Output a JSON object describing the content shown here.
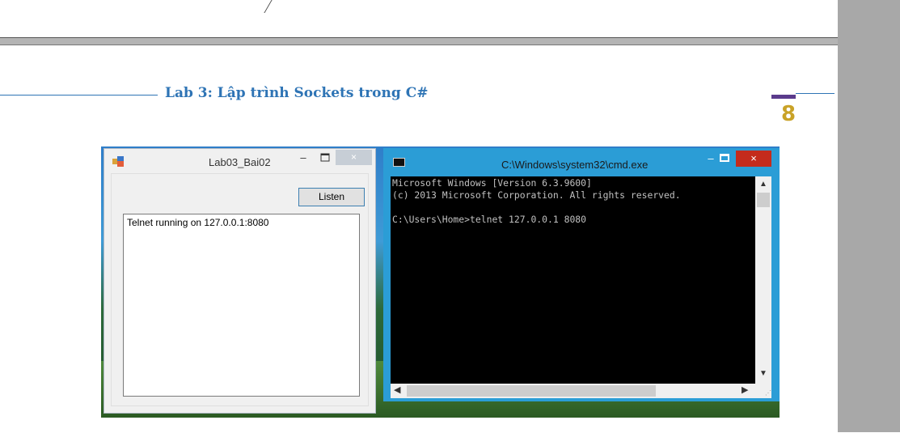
{
  "document": {
    "header_title": "Lab 3: Lập trình Sockets trong C#",
    "page_number": "8"
  },
  "form_window": {
    "title": "Lab03_Bai02",
    "listen_button_label": "Listen",
    "output_text": "Telnet running on 127.0.0.1:8080",
    "close_glyph": "×",
    "minimize_glyph": "–"
  },
  "cmd_window": {
    "title": "C:\\Windows\\system32\\cmd.exe",
    "lines": [
      "Microsoft Windows [Version 6.3.9600]",
      "(c) 2013 Microsoft Corporation. All rights reserved.",
      "",
      "C:\\Users\\Home>telnet 127.0.0.1 8080"
    ],
    "close_glyph": "×",
    "minimize_glyph": "–"
  },
  "colors": {
    "header_blue": "#2e74b5",
    "page_number_gold": "#c9a227",
    "cmd_close_red": "#c42b1c",
    "cmd_frame_blue": "#2b9dd6"
  }
}
